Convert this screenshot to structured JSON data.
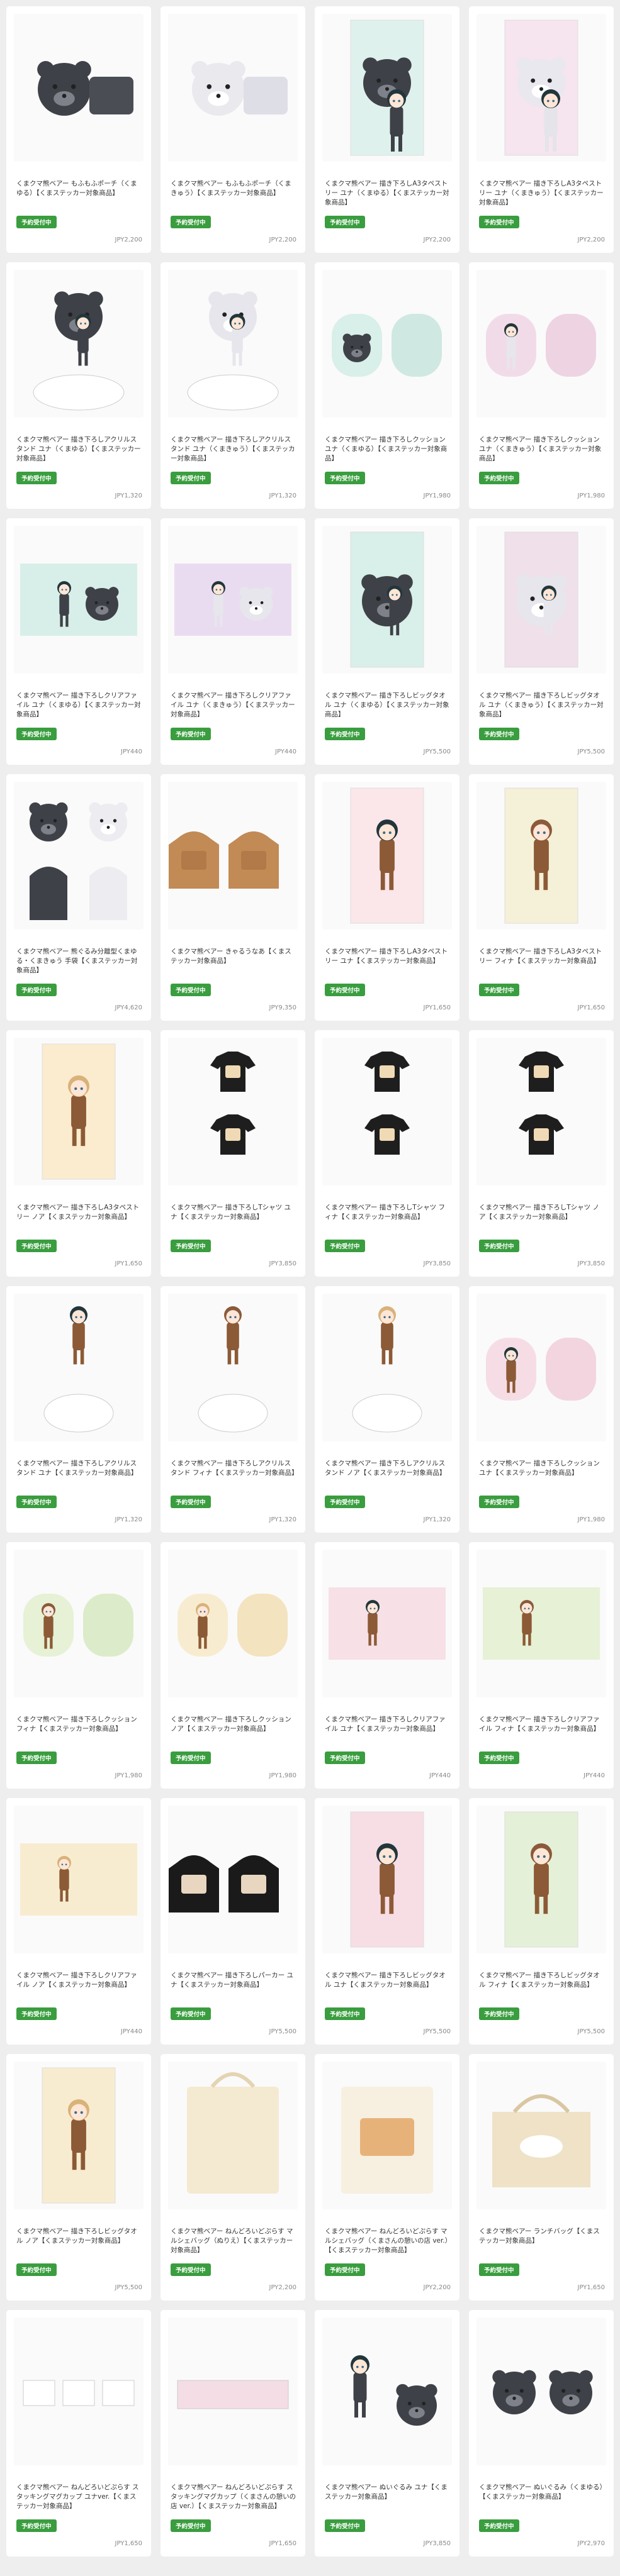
{
  "products": [
    {
      "title": "くまクマ熊ベアー もふもふポーチ（くまゆる）【くまステッカー対象商品】",
      "badge": "予約受付中",
      "price": "JPY2,200",
      "art": "pouch-black"
    },
    {
      "title": "くまクマ熊ベアー もふもふポーチ（くまきゅう）【くまステッカー対象商品】",
      "badge": "予約受付中",
      "price": "JPY2,200",
      "art": "pouch-white"
    },
    {
      "title": "くまクマ熊ベアー 描き下ろしA3タペストリー ユナ（くまゆる）【くまステッカー対象商品】",
      "badge": "予約受付中",
      "price": "JPY2,200",
      "art": "tapestry-yuna-black"
    },
    {
      "title": "くまクマ熊ベアー 描き下ろしA3タペストリー ユナ（くまきゅう）【くまステッカー対象商品】",
      "badge": "予約受付中",
      "price": "JPY2,200",
      "art": "tapestry-yuna-white"
    },
    {
      "title": "くまクマ熊ベアー 描き下ろしアクリルスタンド ユナ（くまゆる）【くまステッカー対象商品】",
      "badge": "予約受付中",
      "price": "JPY1,320",
      "art": "stand-black"
    },
    {
      "title": "くまクマ熊ベアー 描き下ろしアクリルスタンド ユナ（くまきゅう）【くまステッカー対象商品】",
      "badge": "予約受付中",
      "price": "JPY1,320",
      "art": "stand-white"
    },
    {
      "title": "くまクマ熊ベアー 描き下ろしクッション ユナ（くまゆる）【くまステッカー対象商品】",
      "badge": "予約受付中",
      "price": "JPY1,980",
      "art": "cushion-mint"
    },
    {
      "title": "くまクマ熊ベアー 描き下ろしクッション ユナ（くまきゅう）【くまステッカー対象商品】",
      "badge": "予約受付中",
      "price": "JPY1,980",
      "art": "cushion-pink"
    },
    {
      "title": "くまクマ熊ベアー 描き下ろしクリアファイル ユナ（くまゆる）【くまステッカー対象商品】",
      "badge": "予約受付中",
      "price": "JPY440",
      "art": "file-mint"
    },
    {
      "title": "くまクマ熊ベアー 描き下ろしクリアファイル ユナ（くまきゅう）【くまステッカー対象商品】",
      "badge": "予約受付中",
      "price": "JPY440",
      "art": "file-lilac"
    },
    {
      "title": "くまクマ熊ベアー 描き下ろしビッグタオル ユナ（くまゆる）【くまステッカー対象商品】",
      "badge": "予約受付中",
      "price": "JPY5,500",
      "art": "towel-black"
    },
    {
      "title": "くまクマ熊ベアー 描き下ろしビッグタオル ユナ（くまきゅう）【くまステッカー対象商品】",
      "badge": "予約受付中",
      "price": "JPY5,500",
      "art": "towel-white"
    },
    {
      "title": "くまクマ熊ベアー 熊ぐるみ分離型くまゆる・くまきゅう 手袋【くまステッカー対象商品】",
      "badge": "予約受付中",
      "price": "JPY4,620",
      "art": "gloves"
    },
    {
      "title": "くまクマ熊ベアー きゃるうなあ【くまステッカー対象商品】",
      "badge": "予約受付中",
      "price": "JPY9,350",
      "art": "hoodie-brown"
    },
    {
      "title": "くまクマ熊ベアー 描き下ろしA3タペストリー ユナ【くまステッカー対象商品】",
      "badge": "予約受付中",
      "price": "JPY1,650",
      "art": "tapestry-yuna"
    },
    {
      "title": "くまクマ熊ベアー 描き下ろしA3タペストリー フィナ【くまステッカー対象商品】",
      "badge": "予約受付中",
      "price": "JPY1,650",
      "art": "tapestry-fina"
    },
    {
      "title": "くまクマ熊ベアー 描き下ろしA3タペストリー ノア【くまステッカー対象商品】",
      "badge": "予約受付中",
      "price": "JPY1,650",
      "art": "tapestry-noa"
    },
    {
      "title": "くまクマ熊ベアー 描き下ろしTシャツ ユナ【くまステッカー対象商品】",
      "badge": "予約受付中",
      "price": "JPY3,850",
      "art": "tshirt"
    },
    {
      "title": "くまクマ熊ベアー 描き下ろしTシャツ フィナ【くまステッカー対象商品】",
      "badge": "予約受付中",
      "price": "JPY3,850",
      "art": "tshirt"
    },
    {
      "title": "くまクマ熊ベアー 描き下ろしTシャツ ノア【くまステッカー対象商品】",
      "badge": "予約受付中",
      "price": "JPY3,850",
      "art": "tshirt"
    },
    {
      "title": "くまクマ熊ベアー 描き下ろしアクリルスタンド ユナ【くまステッカー対象商品】",
      "badge": "予約受付中",
      "price": "JPY1,320",
      "art": "stand-yuna"
    },
    {
      "title": "くまクマ熊ベアー 描き下ろしアクリルスタンド フィナ【くまステッカー対象商品】",
      "badge": "予約受付中",
      "price": "JPY1,320",
      "art": "stand-fina"
    },
    {
      "title": "くまクマ熊ベアー 描き下ろしアクリルスタンド ノア【くまステッカー対象商品】",
      "badge": "予約受付中",
      "price": "JPY1,320",
      "art": "stand-noa"
    },
    {
      "title": "くまクマ熊ベアー 描き下ろしクッション ユナ【くまステッカー対象商品】",
      "badge": "予約受付中",
      "price": "JPY1,980",
      "art": "cushion-pink2"
    },
    {
      "title": "くまクマ熊ベアー 描き下ろしクッション フィナ【くまステッカー対象商品】",
      "badge": "予約受付中",
      "price": "JPY1,980",
      "art": "cushion-green"
    },
    {
      "title": "くまクマ熊ベアー 描き下ろしクッション ノア【くまステッカー対象商品】",
      "badge": "予約受付中",
      "price": "JPY1,980",
      "art": "cushion-yellow"
    },
    {
      "title": "くまクマ熊ベアー 描き下ろしクリアファイル ユナ【くまステッカー対象商品】",
      "badge": "予約受付中",
      "price": "JPY440",
      "art": "file-pink"
    },
    {
      "title": "くまクマ熊ベアー 描き下ろしクリアファイル フィナ【くまステッカー対象商品】",
      "badge": "予約受付中",
      "price": "JPY440",
      "art": "file-green"
    },
    {
      "title": "くまクマ熊ベアー 描き下ろしクリアファイル ノア【くまステッカー対象商品】",
      "badge": "予約受付中",
      "price": "JPY440",
      "art": "file-yellow"
    },
    {
      "title": "くまクマ熊ベアー 描き下ろしパーカー ユナ【くまステッカー対象商品】",
      "badge": "予約受付中",
      "price": "JPY5,500",
      "art": "hoodie-black"
    },
    {
      "title": "くまクマ熊ベアー 描き下ろしビッグタオル ユナ【くまステッカー対象商品】",
      "badge": "予約受付中",
      "price": "JPY5,500",
      "art": "towel-yuna"
    },
    {
      "title": "くまクマ熊ベアー 描き下ろしビッグタオル フィナ【くまステッカー対象商品】",
      "badge": "予約受付中",
      "price": "JPY5,500",
      "art": "towel-fina"
    },
    {
      "title": "くまクマ熊ベアー 描き下ろしビッグタオル ノア【くまステッカー対象商品】",
      "badge": "予約受付中",
      "price": "JPY5,500",
      "art": "towel-noa"
    },
    {
      "title": "くまクマ熊ベアー ねんどろいどぷらす マルシェバッグ（ぬりえ）【くまステッカー対象商品】",
      "badge": "予約受付中",
      "price": "JPY2,200",
      "art": "marche-bag"
    },
    {
      "title": "くまクマ熊ベアー ねんどろいどぷらす マルシェバッグ（くまさんの憩いの店 ver.）【くまステッカー対象商品】",
      "badge": "予約受付中",
      "price": "JPY2,200",
      "art": "marche-shop"
    },
    {
      "title": "くまクマ熊ベアー ランチバッグ【くまステッカー対象商品】",
      "badge": "予約受付中",
      "price": "JPY1,650",
      "art": "lunch-bag"
    },
    {
      "title": "くまクマ熊ベアー ねんどろいどぷらす スタッキングマグカップ ユナver.【くまステッカー対象商品】",
      "badge": "予約受付中",
      "price": "JPY1,650",
      "art": "mug-yuna"
    },
    {
      "title": "くまクマ熊ベアー ねんどろいどぷらす スタッキングマグカップ（くまさんの憩いの店 ver.）【くまステッカー対象商品】",
      "badge": "予約受付中",
      "price": "JPY1,650",
      "art": "mug-shop"
    },
    {
      "title": "くまクマ熊ベアー ぬいぐるみ ユナ【くまステッカー対象商品】",
      "badge": "予約受付中",
      "price": "JPY3,850",
      "art": "plush-yuna"
    },
    {
      "title": "くまクマ熊ベアー ぬいぐるみ（くまゆる）【くまステッカー対象商品】",
      "badge": "予約受付中",
      "price": "JPY2,970",
      "art": "plush-bear"
    }
  ],
  "palette": {
    "badge_green": "#3a9d3f",
    "card_bg": "#ffffff",
    "page_bg": "#eeeeee"
  }
}
